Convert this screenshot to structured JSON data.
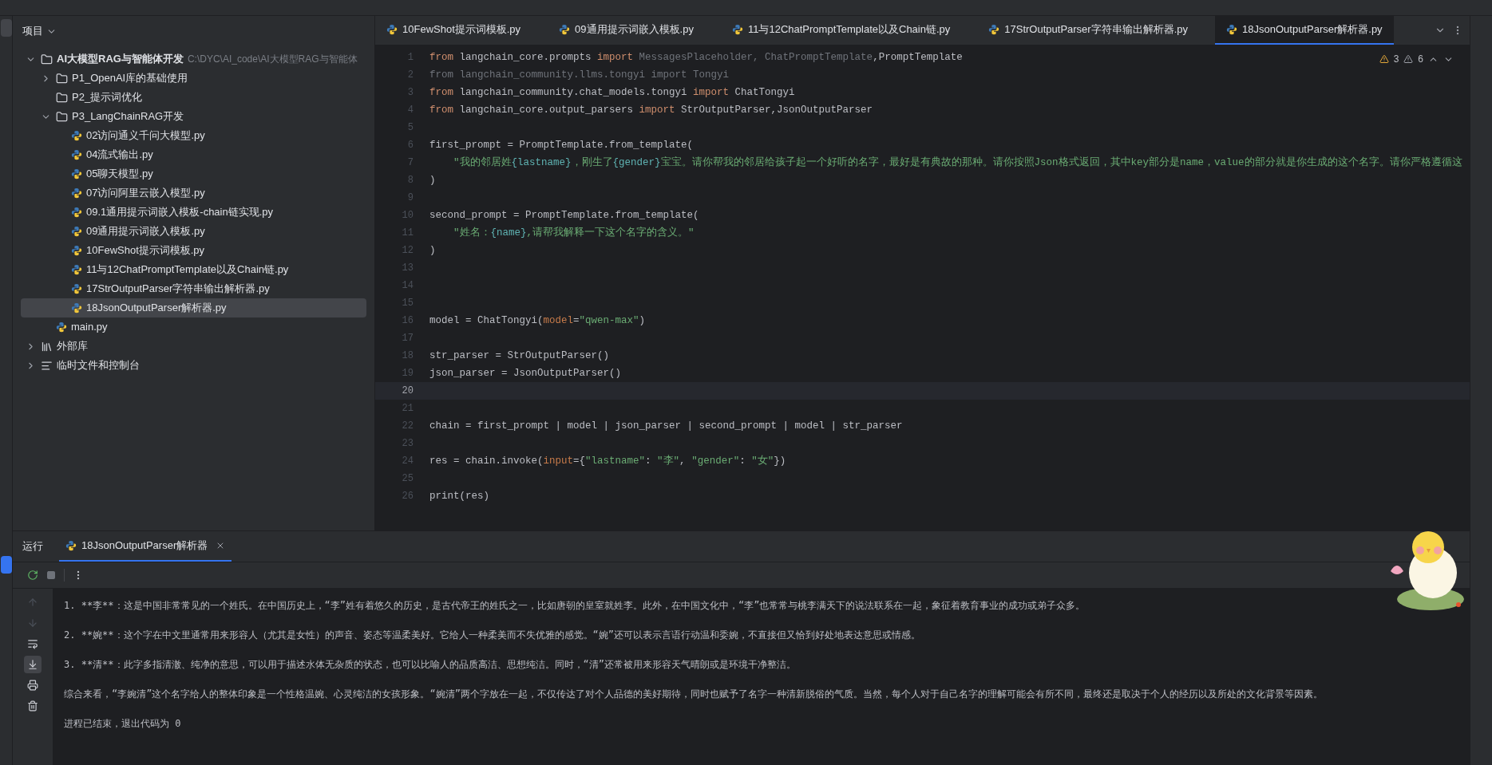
{
  "project_panel": {
    "title": "项目",
    "tree": [
      {
        "kind": "folder",
        "label": "AI大模型RAG与智能体开发",
        "path": "C:\\DYC\\AI_code\\AI大模型RAG与智能体",
        "expanded": true,
        "selected": false,
        "children": [
          {
            "kind": "folder",
            "label": "P1_OpenAI库的基础使用",
            "expanded": false,
            "selected": false
          },
          {
            "kind": "folder",
            "label": "P2_提示词优化",
            "selected": false
          },
          {
            "kind": "folder",
            "label": "P3_LangChainRAG开发",
            "expanded": true,
            "selected": false,
            "children": [
              {
                "kind": "file",
                "label": "02访问通义千问大模型.py",
                "selected": false
              },
              {
                "kind": "file",
                "label": "04流式输出.py",
                "selected": false
              },
              {
                "kind": "file",
                "label": "05聊天模型.py",
                "selected": false
              },
              {
                "kind": "file",
                "label": "07访问阿里云嵌入模型.py",
                "selected": false
              },
              {
                "kind": "file",
                "label": "09.1通用提示词嵌入模板-chain链实现.py",
                "selected": false
              },
              {
                "kind": "file",
                "label": "09通用提示词嵌入模板.py",
                "selected": false
              },
              {
                "kind": "file",
                "label": "10FewShot提示词模板.py",
                "selected": false
              },
              {
                "kind": "file",
                "label": "11与12ChatPromptTemplate以及Chain链.py",
                "selected": false
              },
              {
                "kind": "file",
                "label": "17StrOutputParser字符串输出解析器.py",
                "selected": false
              },
              {
                "kind": "file",
                "label": "18JsonOutputParser解析器.py",
                "selected": true
              }
            ]
          },
          {
            "kind": "file",
            "label": "main.py",
            "selected": false
          }
        ]
      },
      {
        "kind": "library",
        "label": "外部库",
        "expanded": false,
        "selected": false
      },
      {
        "kind": "scratch",
        "label": "临时文件和控制台",
        "expanded": false,
        "selected": false
      }
    ]
  },
  "editor": {
    "tabs": [
      {
        "label": "10FewShot提示词模板.py",
        "selected": false
      },
      {
        "label": "09通用提示词嵌入模板.py",
        "selected": false
      },
      {
        "label": "11与12ChatPromptTemplate以及Chain链.py",
        "selected": false
      },
      {
        "label": "17StrOutputParser字符串输出解析器.py",
        "selected": false
      },
      {
        "label": "18JsonOutputParser解析器.py",
        "selected": true
      }
    ],
    "warnings": "3",
    "weak_warnings": "6",
    "lines": [
      {
        "num": "1",
        "current": false,
        "tokens": [
          {
            "kind": "keyword",
            "text": "from"
          },
          {
            "kind": "plain",
            "text": " langchain_core.prompts "
          },
          {
            "kind": "keyword",
            "text": "import"
          },
          {
            "kind": "unused",
            "text": " MessagesPlaceholder, ChatPromptTemplate"
          },
          {
            "kind": "plain",
            "text": ",PromptTemplate"
          }
        ]
      },
      {
        "num": "2",
        "current": false,
        "tokens": [
          {
            "kind": "unused",
            "text": "from langchain_community.llms.tongyi import Tongyi"
          }
        ]
      },
      {
        "num": "3",
        "current": false,
        "tokens": [
          {
            "kind": "keyword",
            "text": "from"
          },
          {
            "kind": "plain",
            "text": " langchain_community.chat_models.tongyi "
          },
          {
            "kind": "keyword",
            "text": "import"
          },
          {
            "kind": "plain",
            "text": " ChatTongyi"
          }
        ]
      },
      {
        "num": "4",
        "current": false,
        "tokens": [
          {
            "kind": "keyword",
            "text": "from"
          },
          {
            "kind": "plain",
            "text": " langchain_core.output_parsers "
          },
          {
            "kind": "keyword",
            "text": "import"
          },
          {
            "kind": "plain",
            "text": " StrOutputParser,JsonOutputParser"
          }
        ]
      },
      {
        "num": "5",
        "current": false
      },
      {
        "num": "6",
        "current": false,
        "tokens": [
          {
            "kind": "plain",
            "text": "first_prompt = PromptTemplate.from_template("
          }
        ]
      },
      {
        "num": "7",
        "current": false,
        "tokens": [
          {
            "kind": "string",
            "text": "    \"我的邻居姓"
          },
          {
            "kind": "placeholder",
            "text": "{lastname}"
          },
          {
            "kind": "string",
            "text": "，刚生了"
          },
          {
            "kind": "placeholder",
            "text": "{gender}"
          },
          {
            "kind": "string",
            "text": "宝宝。请你帮我的邻居给孩子起一个好听的名字，最好是有典故的那种。请你按照Json格式返回，其中key部分是name，value的部分就是你生成的这个名字。请你严格遵循这"
          }
        ]
      },
      {
        "num": "8",
        "current": false,
        "tokens": [
          {
            "kind": "plain",
            "text": ")"
          }
        ]
      },
      {
        "num": "9",
        "current": false
      },
      {
        "num": "10",
        "current": false,
        "tokens": [
          {
            "kind": "plain",
            "text": "second_prompt = PromptTemplate.from_template("
          }
        ]
      },
      {
        "num": "11",
        "current": false,
        "tokens": [
          {
            "kind": "string",
            "text": "    \"姓名："
          },
          {
            "kind": "placeholder",
            "text": "{name}"
          },
          {
            "kind": "string",
            "text": ",请帮我解释一下这个名字的含义。\""
          }
        ]
      },
      {
        "num": "12",
        "current": false,
        "tokens": [
          {
            "kind": "plain",
            "text": ")"
          }
        ]
      },
      {
        "num": "13",
        "current": false
      },
      {
        "num": "14",
        "current": false
      },
      {
        "num": "15",
        "current": false
      },
      {
        "num": "16",
        "current": false,
        "tokens": [
          {
            "kind": "plain",
            "text": "model = ChatTongyi("
          },
          {
            "kind": "argument",
            "text": "model"
          },
          {
            "kind": "plain",
            "text": "="
          },
          {
            "kind": "string",
            "text": "\"qwen-max\""
          },
          {
            "kind": "plain",
            "text": ")"
          }
        ]
      },
      {
        "num": "17",
        "current": false
      },
      {
        "num": "18",
        "current": false,
        "tokens": [
          {
            "kind": "plain",
            "text": "str_parser = StrOutputParser()"
          }
        ]
      },
      {
        "num": "19",
        "current": false,
        "tokens": [
          {
            "kind": "plain",
            "text": "json_parser = JsonOutputParser()"
          }
        ]
      },
      {
        "num": "20",
        "current": true
      },
      {
        "num": "21",
        "current": false
      },
      {
        "num": "22",
        "current": false,
        "tokens": [
          {
            "kind": "plain",
            "text": "chain = first_prompt | model | json_parser | second_prompt | model | str_parser"
          }
        ]
      },
      {
        "num": "23",
        "current": false
      },
      {
        "num": "24",
        "current": false,
        "tokens": [
          {
            "kind": "plain",
            "text": "res = chain.invoke("
          },
          {
            "kind": "argument",
            "text": "input"
          },
          {
            "kind": "plain",
            "text": "={"
          },
          {
            "kind": "string",
            "text": "\"lastname\""
          },
          {
            "kind": "plain",
            "text": ": "
          },
          {
            "kind": "string",
            "text": "\"李\""
          },
          {
            "kind": "plain",
            "text": ", "
          },
          {
            "kind": "string",
            "text": "\"gender\""
          },
          {
            "kind": "plain",
            "text": ": "
          },
          {
            "kind": "string",
            "text": "\"女\""
          },
          {
            "kind": "plain",
            "text": "})"
          }
        ]
      },
      {
        "num": "25",
        "current": false
      },
      {
        "num": "26",
        "current": false,
        "tokens": [
          {
            "kind": "plain",
            "text": "print(res)"
          }
        ]
      }
    ]
  },
  "run_panel": {
    "title": "运行",
    "tabs": [
      {
        "label": "18JsonOutputParser解析器",
        "selected": true
      }
    ],
    "side_tools": [
      {
        "kind": "up",
        "selected": false
      },
      {
        "kind": "down",
        "selected": false
      },
      {
        "kind": "wrap",
        "selected": false
      },
      {
        "kind": "scroll_end",
        "selected": true
      },
      {
        "kind": "print",
        "selected": false
      },
      {
        "kind": "trash",
        "selected": false
      }
    ],
    "output": [
      "1. **李**：这是中国非常常见的一个姓氏。在中国历史上，“李”姓有着悠久的历史，是古代帝王的姓氏之一，比如唐朝的皇室就姓李。此外，在中国文化中，“李”也常常与桃李满天下的说法联系在一起，象征着教育事业的成功或弟子众多。",
      "2. **婉**：这个字在中文里通常用来形容人（尤其是女性）的声音、姿态等温柔美好。它给人一种柔美而不失优雅的感觉。“婉”还可以表示言语行动温和委婉，不直接但又恰到好处地表达意思或情感。",
      "3. **清**：此字多指清澈、纯净的意思，可以用于描述水体无杂质的状态，也可以比喻人的品质高洁、思想纯洁。同时，“清”还常被用来形容天气晴朗或是环境干净整洁。",
      "综合来看，“李婉清”这个名字给人的整体印象是一个性格温婉、心灵纯洁的女孩形象。“婉清”两个字放在一起，不仅传达了对个人品德的美好期待，同时也赋予了名字一种清新脱俗的气质。当然，每个人对于自己名字的理解可能会有所不同，最终还是取决于个人的经历以及所处的文化背景等因素。",
      "进程已结束，退出代码为 0"
    ]
  }
}
